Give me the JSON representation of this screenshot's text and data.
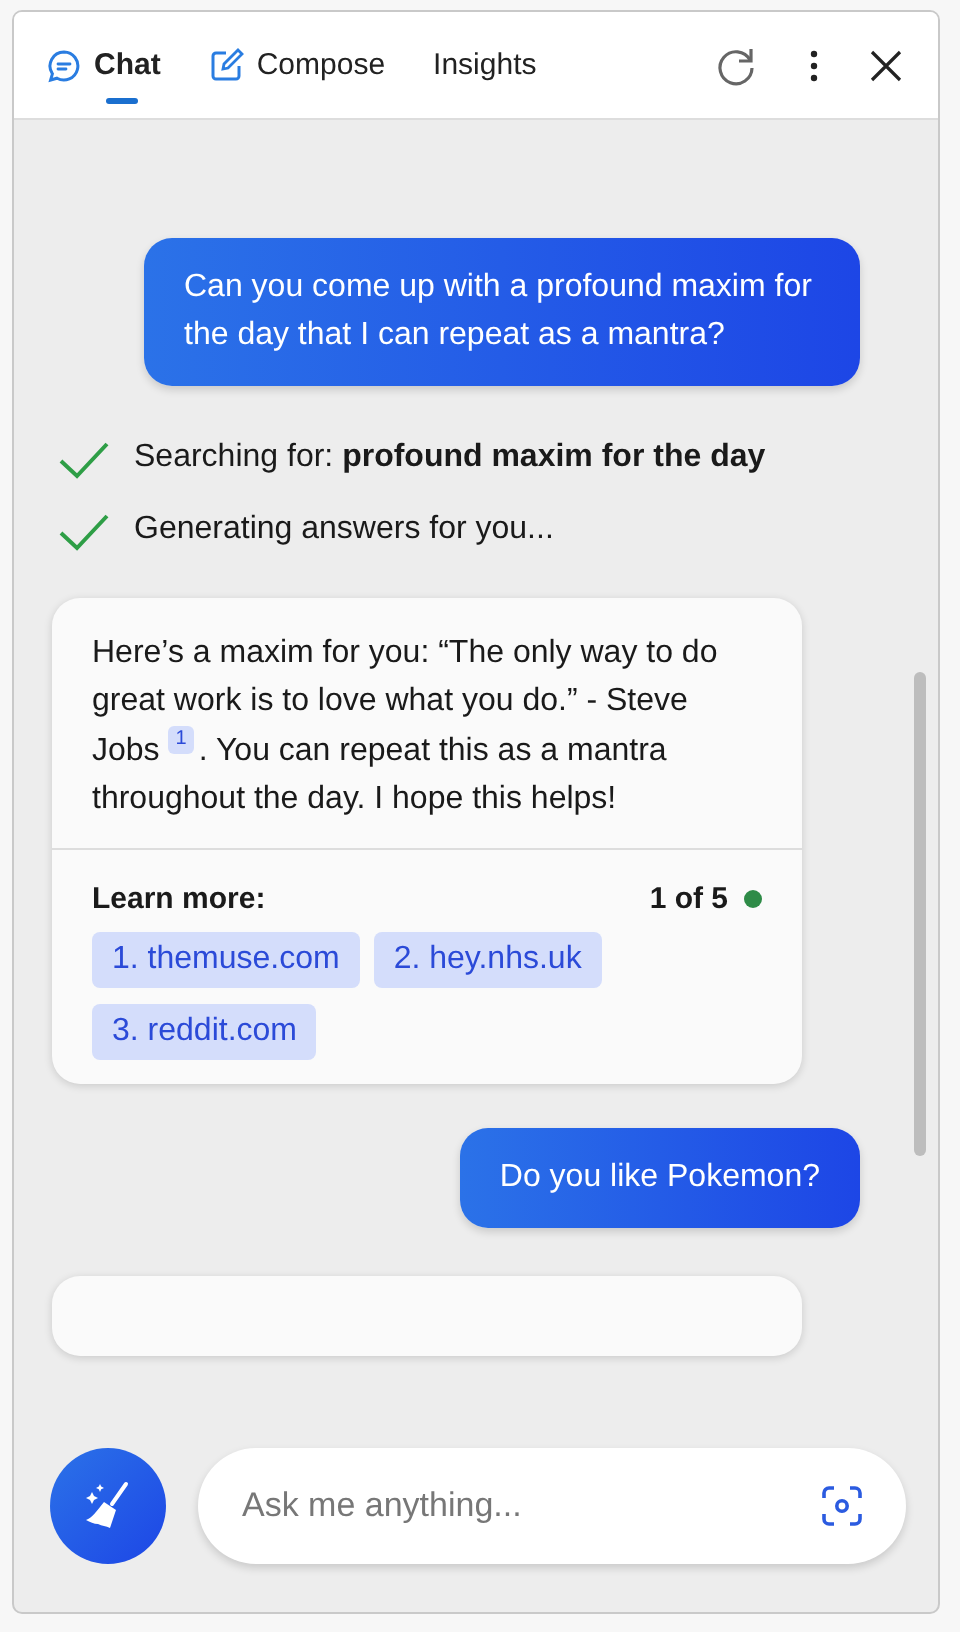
{
  "tabs": [
    {
      "label": "Chat",
      "selected": true
    },
    {
      "label": "Compose",
      "selected": false
    },
    {
      "label": "Insights",
      "selected": false
    }
  ],
  "messages": [
    {
      "kind": "user",
      "text": "Can you come up with a profound maxim for the day that I can repeat as a mantra?"
    },
    {
      "kind": "steps",
      "steps": [
        {
          "text": "Searching for: **profound maxim for the day**",
          "done": true
        },
        {
          "text": "Generating answers for you...",
          "done": true
        }
      ]
    },
    {
      "kind": "answer",
      "text_before": "Here’s a maxim for you: “The only way to do great work is to love what you do.” - Steve Jobs",
      "citation": "1",
      "text_after": ". You can repeat this as a mantra throughout the day. I hope this helps!",
      "learn_more": "Learn more:",
      "page": "1 of 5",
      "links": [
        "1. themuse.com",
        "2. hey.nhs.uk",
        "3. reddit.com"
      ]
    },
    {
      "kind": "user",
      "text": "Do you like Pokemon?"
    },
    {
      "kind": "cut_answer"
    }
  ],
  "input": {
    "placeholder": "Ask me anything..."
  }
}
